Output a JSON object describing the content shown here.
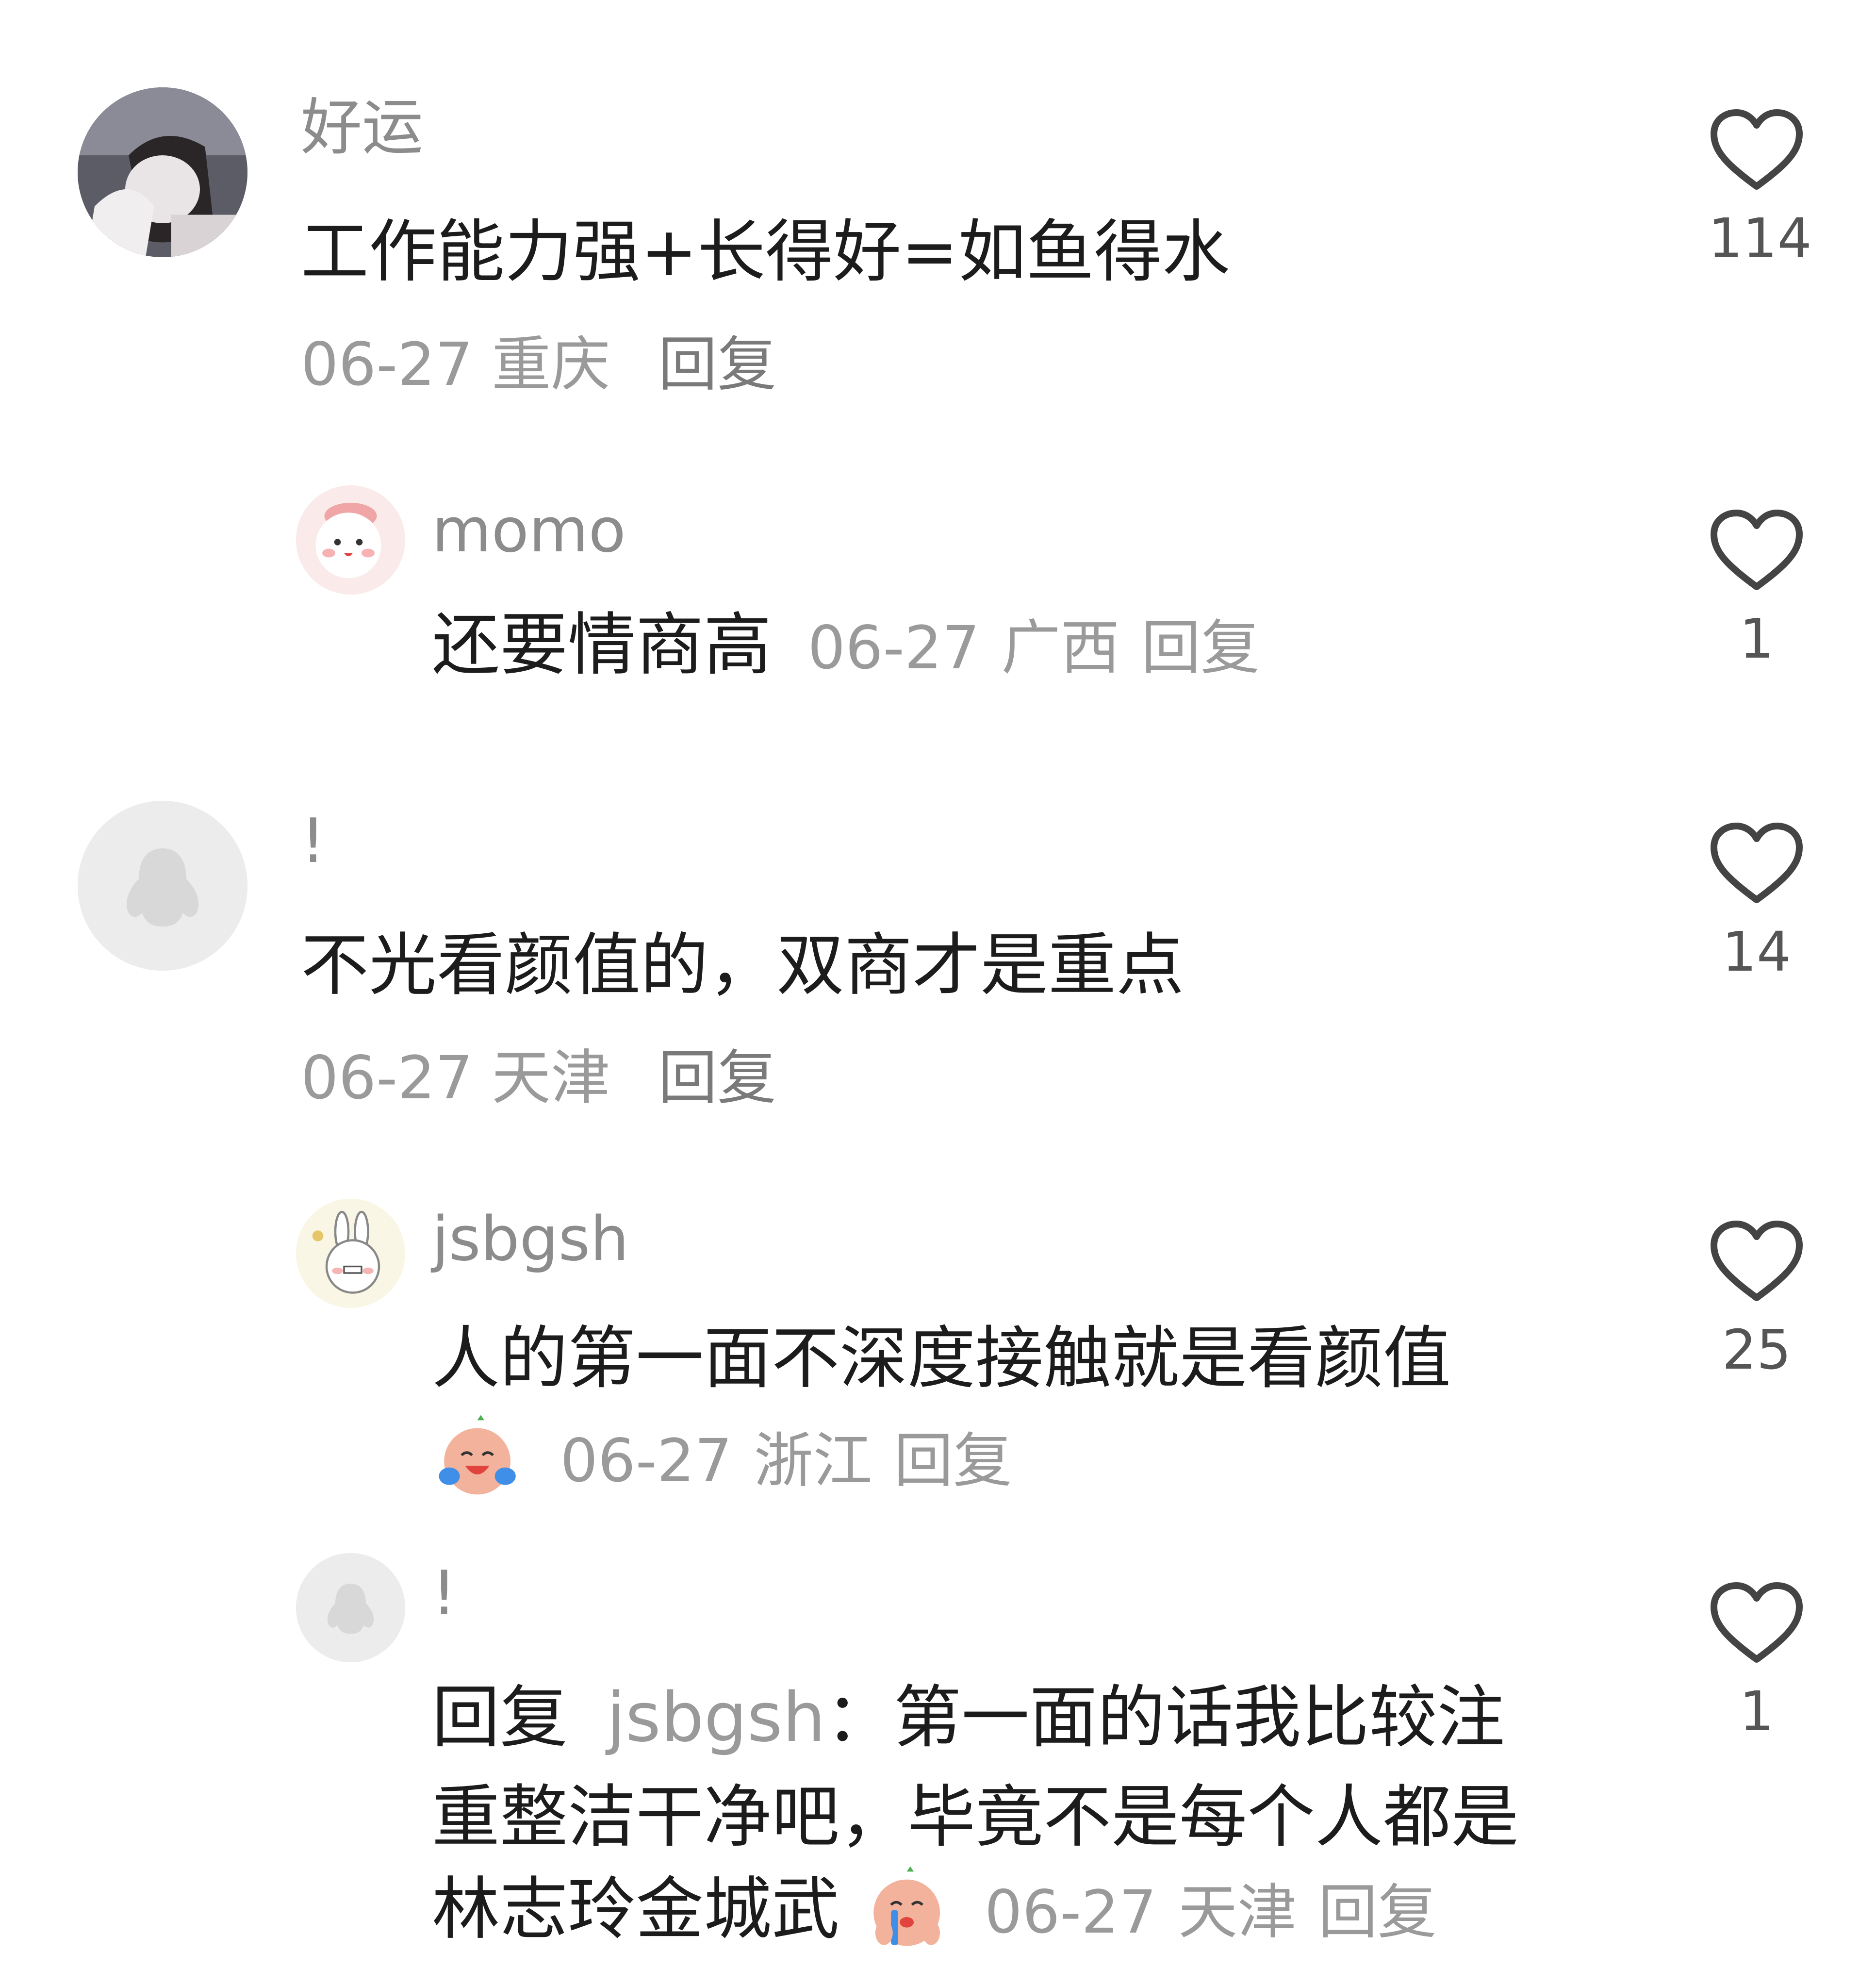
{
  "comments": [
    {
      "username": "好运",
      "text": "工作能力强+长得好=如鱼得水",
      "date": "06-27",
      "location": "重庆",
      "reply_label": "回复",
      "likes": "114",
      "avatar": "photo-avatar"
    },
    {
      "username": "momo",
      "text": "还要情商高",
      "date": "06-27",
      "location": "广西",
      "reply_label": "回复",
      "likes": "1",
      "avatar": "pink-cartoon-avatar"
    },
    {
      "username": "!",
      "text": "不光看颜值的，双商才是重点",
      "date": "06-27",
      "location": "天津",
      "reply_label": "回复",
      "likes": "14",
      "avatar": "default-penguin-avatar"
    },
    {
      "username": "jsbgsh",
      "text": "人的第一面不深度接触就是看颜值",
      "date": "06-27",
      "location": "浙江",
      "reply_label": "回复",
      "likes": "25",
      "avatar": "bunny-cartoon-avatar",
      "emoji": "crying-laughing-emoji"
    },
    {
      "username": "!",
      "reply_prefix": "回复",
      "mention": "jsbgsh",
      "line1": "：第一面的话我比较注",
      "line2": "重整洁干净吧，毕竟不是每个人都是",
      "line3": "林志玲金城武",
      "date": "06-27",
      "location": "天津",
      "reply_label": "回复",
      "likes": "1",
      "avatar": "default-penguin-avatar",
      "emoji": "crying-emoji"
    }
  ],
  "colors": {
    "username": "#8c8c8c",
    "text": "#1c1c1c",
    "meta": "#9a9a9a",
    "heart_stroke": "#444444"
  }
}
